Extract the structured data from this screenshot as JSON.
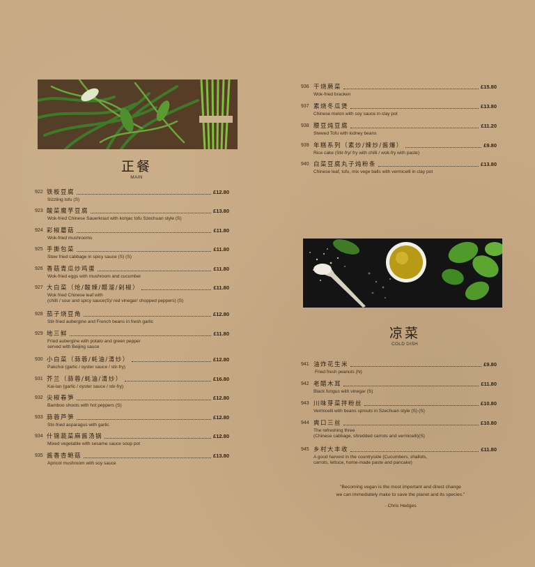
{
  "main": {
    "title_zh": "正餐",
    "title_en": "MAIN",
    "items": [
      {
        "num": "922",
        "name": "铁板豆腐",
        "price": "£12.80",
        "desc": "Sizzling tofu  (S)"
      },
      {
        "num": "923",
        "name": "酸菜魔芋豆腐",
        "price": "£13.80",
        "desc": "Wok-fried Chinese Sauerkraut with konjac tofu Szechuan style  (S)"
      },
      {
        "num": "924",
        "name": "彩椒蘑菇",
        "price": "£11.80",
        "desc": "Wok-fried mushrooms"
      },
      {
        "num": "925",
        "name": "手撕包菜",
        "price": "£11.80",
        "desc": "Stew fried cabbage in spicy sauce    (S)  (S)"
      },
      {
        "num": "926",
        "name": "香菇青瓜炒鸡蛋",
        "price": "£11.80",
        "desc": "Wok-fried eggs with mushroom and cucumber"
      },
      {
        "num": "927",
        "name": "大白菜（炝/酸辣/醋溜/剁椒）",
        "price": "£11.80",
        "desc": "Wok fried Chinese leaf  with\n(chilli / sour and spicy sauce(S)/ red vinegar/ chopped peppers) (S)"
      },
      {
        "num": "928",
        "name": "茄子烧豆角",
        "price": "£12.80",
        "desc": "Stir-fried aubergine and French beans in fresh garlic"
      },
      {
        "num": "929",
        "name": "地三鲜",
        "price": "£11.80",
        "desc": "Fried aubergine with potato and green pepper\nserved with Beijing sauce"
      },
      {
        "num": "930",
        "name": "小白菜（蒜蓉/蚝油/清炒）",
        "price": "£12.80",
        "desc": "Pakchoi (garlic / oyster sauce / stir-fry)"
      },
      {
        "num": "931",
        "name": "芥兰（蒜蓉/蚝油/清炒）",
        "price": "£16.80",
        "desc": "Kai-lan (garlic / oyster sauce / stir-fry)"
      },
      {
        "num": "932",
        "name": "尖椒春笋",
        "price": "£12.80",
        "desc": "Bamboo shoots with hot peppers  (S)"
      },
      {
        "num": "933",
        "name": "蒜蓉芦笋",
        "price": "£12.80",
        "desc": "Stir-fried asparagus with garlic"
      },
      {
        "num": "934",
        "name": "什锦蔬菜麻酱汤锅",
        "price": "£12.80",
        "desc": "Mixed vegetable with sesame sauce soup pot"
      },
      {
        "num": "935",
        "name": "酱香杏鲍菇",
        "price": "£13.80",
        "desc": "Apricot mushroom with soy sauce"
      }
    ]
  },
  "main_cont": {
    "items": [
      {
        "num": "936",
        "name": "干烧蕨菜",
        "price": "£15.80",
        "desc": "Wok-fried bracken"
      },
      {
        "num": "937",
        "name": "素烧冬瓜煲",
        "price": "£13.80",
        "desc": "Chinese melon with soy sauce in clay pot"
      },
      {
        "num": "938",
        "name": "腰豆炖豆腐",
        "price": "£11.20",
        "desc": "Stewed Tofu with kidney beans"
      },
      {
        "num": "939",
        "name": "年糕系列（素炒/辣炒/酱爆）",
        "price": "£9.80",
        "desc": "Rice cake (Stir-fry/ fry with chilli / wok-fry with paste)"
      },
      {
        "num": "940",
        "name": "白菜豆腐丸子炖粉条",
        "price": "£13.80",
        "desc": "Chinese leaf, tofu, mix vege balls with vermicelli in clay pot"
      }
    ]
  },
  "cold": {
    "title_zh": "凉菜",
    "title_en": "COLD DISH",
    "items": [
      {
        "num": "941",
        "name": "油炸花生米",
        "price": "£9.80",
        "desc": "Fried fresh peanuts  (N)"
      },
      {
        "num": "942",
        "name": "老醋木耳",
        "price": "£11.80",
        "desc": "Black fungus with vinegar   (S)"
      },
      {
        "num": "943",
        "name": "川味芽菜拌粉丝",
        "price": "£10.80",
        "desc": "Vermicelli with beans sprouts in Szechuan style  (S)  (S)"
      },
      {
        "num": "944",
        "name": "爽口三丝",
        "price": "£10.80",
        "desc": "The refreshing three\n(Chinese cabbage, shredded carrots and vermicelli)(S)"
      },
      {
        "num": "945",
        "name": "乡村大丰收",
        "price": "£11.80",
        "desc": "A good harvest in the countryside (Cucumbers, shallots,\ncarrots, lettuce, home-made paste and pancake)"
      }
    ]
  },
  "quote": {
    "text": "\"Becoming vegan is the most important and direct change\nwe can immediately make to save the planet and its species.\"",
    "author": "- Chris Hedges"
  }
}
